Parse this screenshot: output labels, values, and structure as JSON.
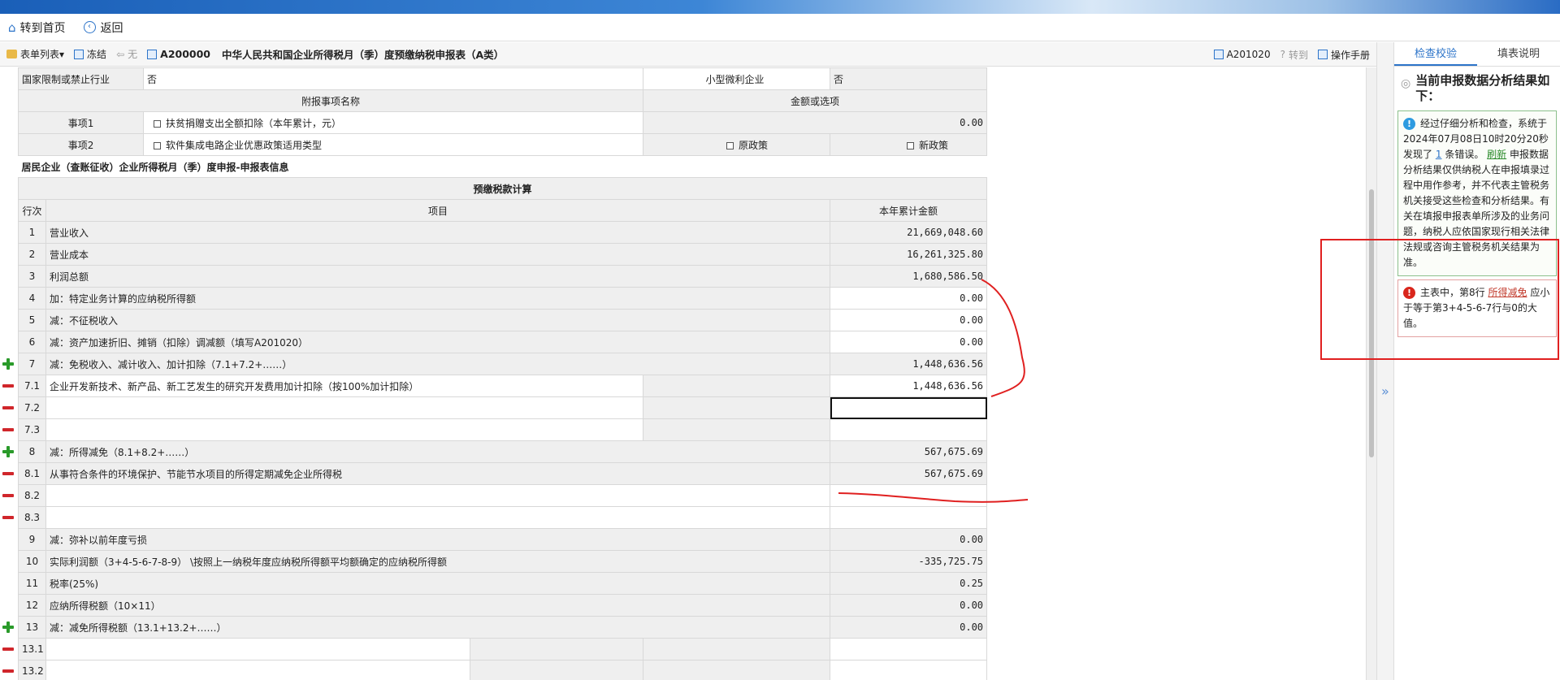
{
  "nav": {
    "home_label": "转到首页",
    "back_label": "返回"
  },
  "toolbar": {
    "form_list_label": "表单列表",
    "freeze_label": "冻结",
    "none_label": "无",
    "form_code": "A200000",
    "form_title": "中华人民共和国企业所得税月（季）度预缴纳税申报表（A类）",
    "next_form_code": "A201020",
    "goto_label": "转到",
    "manual_label": "操作手册"
  },
  "form": {
    "restricted_industry_label": "国家限制或禁止行业",
    "restricted_industry_value": "否",
    "small_micro_label": "小型微利企业",
    "small_micro_value": "否",
    "appendix_header_name": "附报事项名称",
    "appendix_header_value": "金额或选项",
    "item1_label": "事项1",
    "item1_text": "扶贫捐赠支出全额扣除（本年累计，元）",
    "item1_value": "0.00",
    "item2_label": "事项2",
    "item2_text": "软件集成电路企业优惠政策适用类型",
    "item2_opt1": "原政策",
    "item2_opt2": "新政策",
    "section_title": "居民企业（查账征收）企业所得税月（季）度申报-申报表信息",
    "calc_title": "预缴税款计算",
    "col_line": "行次",
    "col_item": "项目",
    "col_amount": "本年累计金额",
    "rows": [
      {
        "no": "1",
        "label": "营业收入",
        "value": "21,669,048.60"
      },
      {
        "no": "2",
        "label": "营业成本",
        "value": "16,261,325.80"
      },
      {
        "no": "3",
        "label": "利润总额",
        "value": "1,680,586.50"
      },
      {
        "no": "4",
        "label": "加：特定业务计算的应纳税所得额",
        "value": "0.00"
      },
      {
        "no": "5",
        "label": "减：不征税收入",
        "value": "0.00"
      },
      {
        "no": "6",
        "label": "减：资产加速折旧、摊销（扣除）调减额（填写A201020）",
        "value": "0.00"
      },
      {
        "no": "7",
        "label": "减：免税收入、减计收入、加计扣除（7.1+7.2+……）",
        "value": "1,448,636.56"
      },
      {
        "no": "7.1",
        "label": "企业开发新技术、新产品、新工艺发生的研究开发费用加计扣除（按100%加计扣除）",
        "value": "1,448,636.56"
      },
      {
        "no": "7.2",
        "label": "",
        "value": ""
      },
      {
        "no": "7.3",
        "label": "",
        "value": ""
      },
      {
        "no": "8",
        "label": "减：所得减免（8.1+8.2+……）",
        "value": "567,675.69"
      },
      {
        "no": "8.1",
        "label": "从事符合条件的环境保护、节能节水项目的所得定期减免企业所得税",
        "value": "567,675.69"
      },
      {
        "no": "8.2",
        "label": "",
        "value": ""
      },
      {
        "no": "8.3",
        "label": "",
        "value": ""
      },
      {
        "no": "9",
        "label": "减：弥补以前年度亏损",
        "value": "0.00"
      },
      {
        "no": "10",
        "label": "实际利润额（3+4-5-6-7-8-9） \\按照上一纳税年度应纳税所得额平均额确定的应纳税所得额",
        "value": "-335,725.75"
      },
      {
        "no": "11",
        "label": "税率(25%)",
        "value": "0.25"
      },
      {
        "no": "12",
        "label": "应纳所得税额（10×11）",
        "value": "0.00"
      },
      {
        "no": "13",
        "label": "减：减免所得税额（13.1+13.2+……）",
        "value": "0.00"
      },
      {
        "no": "13.1",
        "label": "",
        "value": ""
      },
      {
        "no": "13.2",
        "label": "",
        "value": ""
      }
    ]
  },
  "side": {
    "tab_check": "检查校验",
    "tab_help": "填表说明",
    "header": "当前申报数据分析结果如下：",
    "info_pre": "经过仔细分析和检查，系统于2024年07月08日10时20分20秒发现了",
    "info_count": "1",
    "info_mid": "条错误。",
    "info_refresh": "刷新",
    "info_disclaimer": "申报数据分析结果仅供纳税人在申报填录过程中用作参考，并不代表主管税务机关接受这些检查和分析结果。有关在填报申报表单所涉及的业务问题，纳税人应依国家现行相关法律法规或咨询主管税务机关结果为准。",
    "error_pre": "主表中，第8行",
    "error_link": "所得减免",
    "error_post": "应小于等于第3+4-5-6-7行与0的大值。",
    "toggle_glyph": "»"
  },
  "colors": {
    "accent": "#2d74c9",
    "error": "#d9261c",
    "annotation": "#e02020"
  }
}
